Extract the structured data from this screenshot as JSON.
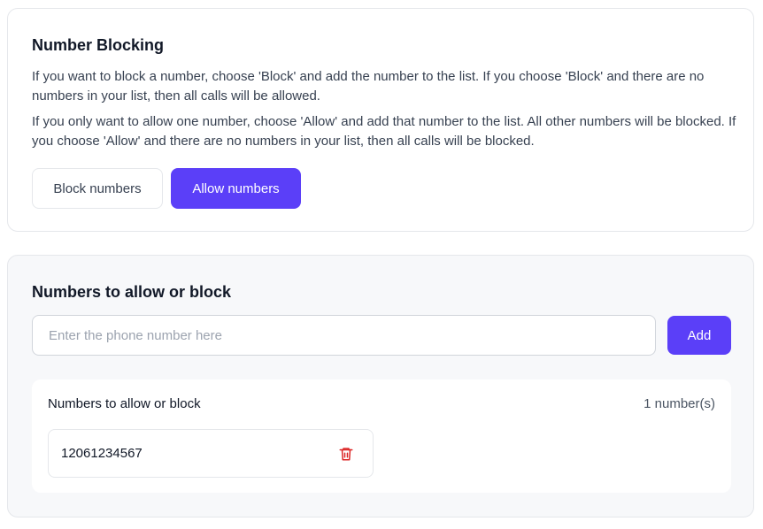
{
  "blocking": {
    "title": "Number Blocking",
    "paragraph1": "If you want to block a number, choose 'Block' and add the number to the list. If you choose 'Block' and there are no numbers in your list, then all calls will be allowed.",
    "paragraph2": "If you only want to allow one number, choose 'Allow' and add that number to the list. All other numbers will be blocked. If you choose 'Allow' and there are no numbers in your list, then all calls will be blocked.",
    "block_button_label": "Block numbers",
    "allow_button_label": "Allow numbers",
    "selected_mode": "allow"
  },
  "numbers": {
    "title": "Numbers to allow or block",
    "input_placeholder": "Enter the phone number here",
    "input_value": "",
    "add_button_label": "Add",
    "list_label": "Numbers to allow or block",
    "count_label": "1 number(s)",
    "items": [
      {
        "number": "12061234567",
        "icon": "trash-icon"
      }
    ]
  },
  "colors": {
    "accent": "#5b3ff8",
    "delete_icon": "#dc2626"
  }
}
